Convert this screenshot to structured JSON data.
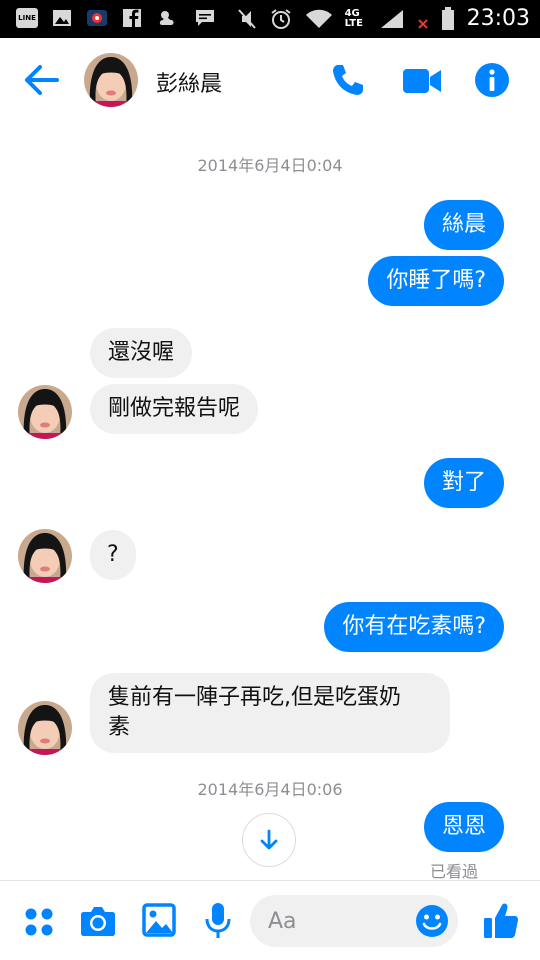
{
  "status_bar": {
    "time": "23:03",
    "network": "4G LTE",
    "icons": [
      "line-icon",
      "gallery-icon",
      "camera-app-icon",
      "facebook-icon",
      "weather-icon",
      "message-icon",
      "mute-icon",
      "alarm-icon",
      "wifi-icon",
      "signal-icon",
      "battery-icon"
    ]
  },
  "header": {
    "contact_name": "彭絲晨",
    "icons": [
      "back-arrow-icon",
      "phone-icon",
      "video-icon",
      "info-icon"
    ],
    "accent": "#0084ff"
  },
  "messages": {
    "ts1": "2014年6月4日0:04",
    "m1": "絲晨",
    "m2": "你睡了嗎?",
    "m3": "還沒喔",
    "m4": "剛做完報告呢",
    "m5": "對了",
    "m6": "?",
    "m7": "你有在吃素嗎?",
    "m8": "隻前有一陣子再吃,但是吃蛋奶\n素",
    "ts2": "2014年6月4日0:06",
    "m9": "恩恩",
    "seen": "已看過"
  },
  "composer": {
    "placeholder": "Aa",
    "icons": [
      "apps-icon",
      "camera-icon",
      "image-icon",
      "mic-icon",
      "emoji-icon",
      "like-icon"
    ]
  },
  "colors": {
    "outgoing_bubble": "#0084ff",
    "incoming_bubble": "#f1f0f0"
  }
}
